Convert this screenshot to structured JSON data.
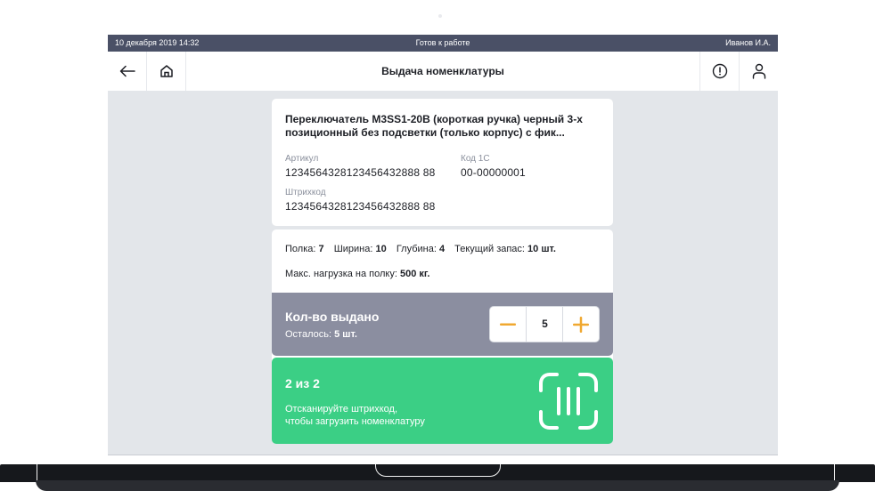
{
  "status_bar": {
    "datetime": "10 декабря 2019 14:32",
    "status": "Готов к работе",
    "user": "Иванов И.А."
  },
  "header": {
    "title": "Выдача номенклатуры",
    "icons": [
      "arrow-left-icon",
      "home-icon",
      "alert-circle-icon",
      "user-icon"
    ]
  },
  "item": {
    "name_line1": "Переключатель M3SS1-20B (короткая ручка) черный 3-х",
    "name_line2": "позиционный без подсветки (только корпус) с фик...",
    "article_label": "Артикул",
    "article_value": "1234564328123456432888 88",
    "code_label": "Код 1С",
    "code_value": "00-00000001",
    "barcode_label": "Штрихкод",
    "barcode_value": "1234564328123456432888 88"
  },
  "params": {
    "shelf_label": "Полка:",
    "shelf_value": "7",
    "width_label": "Ширина:",
    "width_value": "10",
    "depth_label": "Глубина:",
    "depth_value": "4",
    "stock_label": "Текущий запас:",
    "stock_value": "10 шт.",
    "max_load_label": "Макс. нагрузка на полку:",
    "max_load_value": "500 кг."
  },
  "quantity": {
    "label": "Кол-во выдано",
    "remaining_label": "Осталось:",
    "remaining_value": "5 шт.",
    "value": "5",
    "minus": "−",
    "plus": "+"
  },
  "scan": {
    "count": "2 из 2",
    "hint_line1": "Отсканируйте штрихкод,",
    "hint_line2": "чтобы загрузить номенклатуру"
  },
  "colors": {
    "status_bar": "#4a5066",
    "accent_orange": "#f0a830",
    "qty_panel": "#8b8ea0",
    "scan_green": "#3bcf85",
    "background": "#e3e6ea"
  }
}
